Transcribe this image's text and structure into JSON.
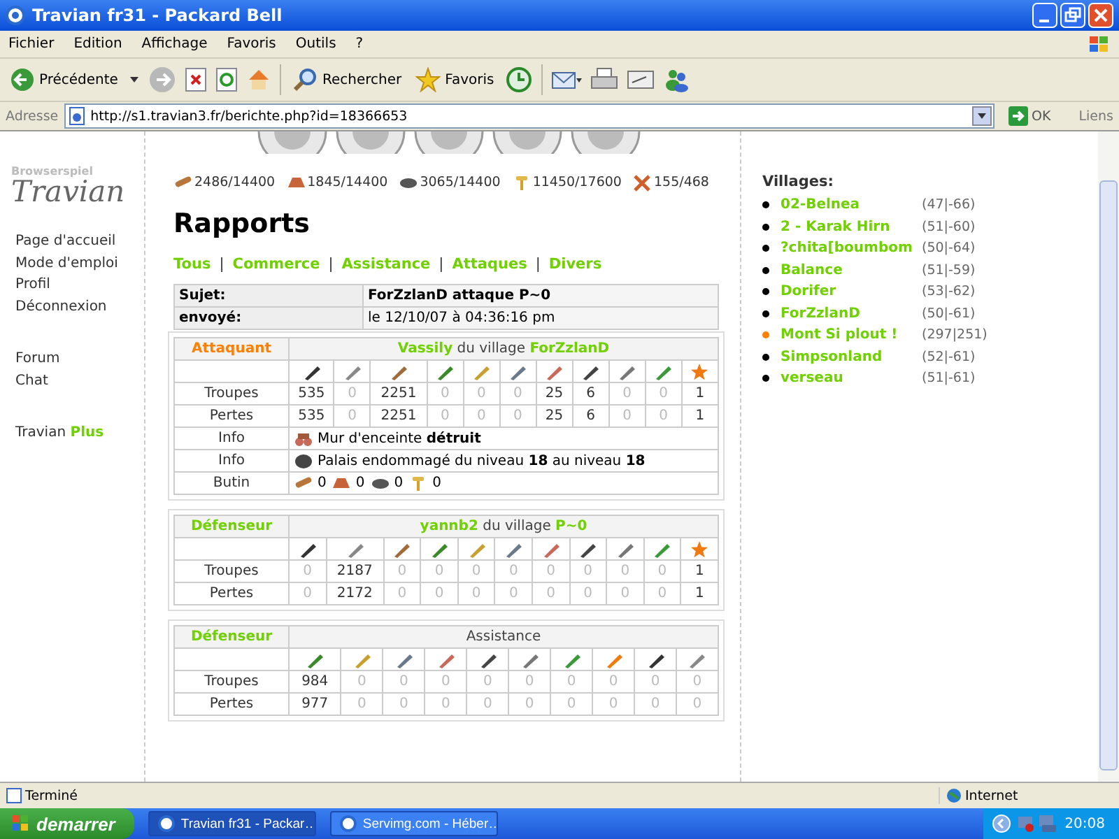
{
  "window": {
    "title": "Travian fr31 - Packard Bell"
  },
  "menu": [
    "Fichier",
    "Edition",
    "Affichage",
    "Favoris",
    "Outils",
    "?"
  ],
  "toolbar": {
    "back": "Précédente",
    "search": "Rechercher",
    "favorites": "Favoris"
  },
  "address": {
    "label": "Adresse",
    "url": "http://s1.travian3.fr/berichte.php?id=18366653",
    "go": "OK",
    "links": "Liens"
  },
  "logo": {
    "subtitle": "Browserspiel",
    "title": "Travian"
  },
  "sidebar": {
    "groups": [
      [
        {
          "label": "Page d'accueil"
        },
        {
          "label": "Mode d'emploi"
        },
        {
          "label": "Profil"
        },
        {
          "label": "Déconnexion"
        }
      ],
      [
        {
          "label": "Forum"
        },
        {
          "label": "Chat"
        }
      ],
      [
        {
          "label": "Travian",
          "accent": "Plus"
        }
      ]
    ]
  },
  "resources": [
    {
      "kind": "wood",
      "value": "2486/14400"
    },
    {
      "kind": "clay",
      "value": "1845/14400"
    },
    {
      "kind": "iron",
      "value": "3065/14400"
    },
    {
      "kind": "crop",
      "value": "11450/17600"
    },
    {
      "kind": "upkeep",
      "value": "155/468"
    }
  ],
  "heading": "Rapports",
  "filters": [
    "Tous",
    "Commerce",
    "Assistance",
    "Attaques",
    "Divers"
  ],
  "filter_separator": "|",
  "report": {
    "subject_label": "Sujet:",
    "subject": "ForZzlanD attaque P~0",
    "sent_label": "envoyé:",
    "sent": "le 12/10/07 à 04:36:16 pm"
  },
  "sections": [
    {
      "kind": "attacker",
      "role": "Attaquant",
      "player": "Vassily",
      "middle": "du village",
      "village": "ForZzlanD",
      "rows": [
        {
          "label": "Troupes",
          "values": [
            "535",
            "0",
            "2251",
            "0",
            "0",
            "0",
            "25",
            "6",
            "0",
            "0",
            "1"
          ]
        },
        {
          "label": "Pertes",
          "values": [
            "535",
            "0",
            "2251",
            "0",
            "0",
            "0",
            "25",
            "6",
            "0",
            "0",
            "1"
          ]
        }
      ],
      "info": [
        {
          "label": "Info",
          "kind": "ram",
          "text": "Mur d'enceinte **détruit**"
        },
        {
          "label": "Info",
          "kind": "catapult",
          "text": "Palais endommagé du niveau **18** au niveau **18**"
        }
      ],
      "loot": {
        "label": "Butin",
        "items": [
          {
            "kind": "wood",
            "value": "0"
          },
          {
            "kind": "clay",
            "value": "0"
          },
          {
            "kind": "iron",
            "value": "0"
          },
          {
            "kind": "crop",
            "value": "0"
          }
        ]
      }
    },
    {
      "kind": "defender",
      "role": "Défenseur",
      "player": "yannb2",
      "middle": "du village",
      "village": "P~0",
      "rows": [
        {
          "label": "Troupes",
          "values": [
            "0",
            "2187",
            "0",
            "0",
            "0",
            "0",
            "0",
            "0",
            "0",
            "0",
            "1"
          ]
        },
        {
          "label": "Pertes",
          "values": [
            "0",
            "2172",
            "0",
            "0",
            "0",
            "0",
            "0",
            "0",
            "0",
            "0",
            "1"
          ]
        }
      ]
    },
    {
      "kind": "defender",
      "role": "Défenseur",
      "title": "Assistance",
      "rows": [
        {
          "label": "Troupes",
          "values": [
            "984",
            "0",
            "0",
            "0",
            "0",
            "0",
            "0",
            "0",
            "0",
            "0"
          ]
        },
        {
          "label": "Pertes",
          "values": [
            "977",
            "0",
            "0",
            "0",
            "0",
            "0",
            "0",
            "0",
            "0",
            "0"
          ]
        }
      ]
    }
  ],
  "villages": {
    "title": "Villages:",
    "items": [
      {
        "name": "02-Belnea",
        "coords": "(47|-66)",
        "selected": false
      },
      {
        "name": "2 - Karak Hirn",
        "coords": "(51|-60)",
        "selected": false
      },
      {
        "name": "?chita[boumbom",
        "coords": "(50|-64)",
        "selected": false
      },
      {
        "name": "Balance",
        "coords": "(51|-59)",
        "selected": false
      },
      {
        "name": "Dorifer",
        "coords": "(53|-62)",
        "selected": false
      },
      {
        "name": "ForZzlanD",
        "coords": "(50|-61)",
        "selected": false
      },
      {
        "name": "Mont Si plout !",
        "coords": "(297|251)",
        "selected": true
      },
      {
        "name": "Simpsonland",
        "coords": "(52|-61)",
        "selected": false
      },
      {
        "name": "verseau",
        "coords": "(51|-61)",
        "selected": false
      }
    ]
  },
  "status_bar": {
    "text": "Terminé",
    "zone": "Internet"
  },
  "taskbar": {
    "start": "demarrer",
    "tasks": [
      {
        "label": "Travian fr31 - Packar…",
        "selected": true
      },
      {
        "label": "Servimg.com - Héber…",
        "selected": false
      }
    ],
    "time": "20:08"
  }
}
